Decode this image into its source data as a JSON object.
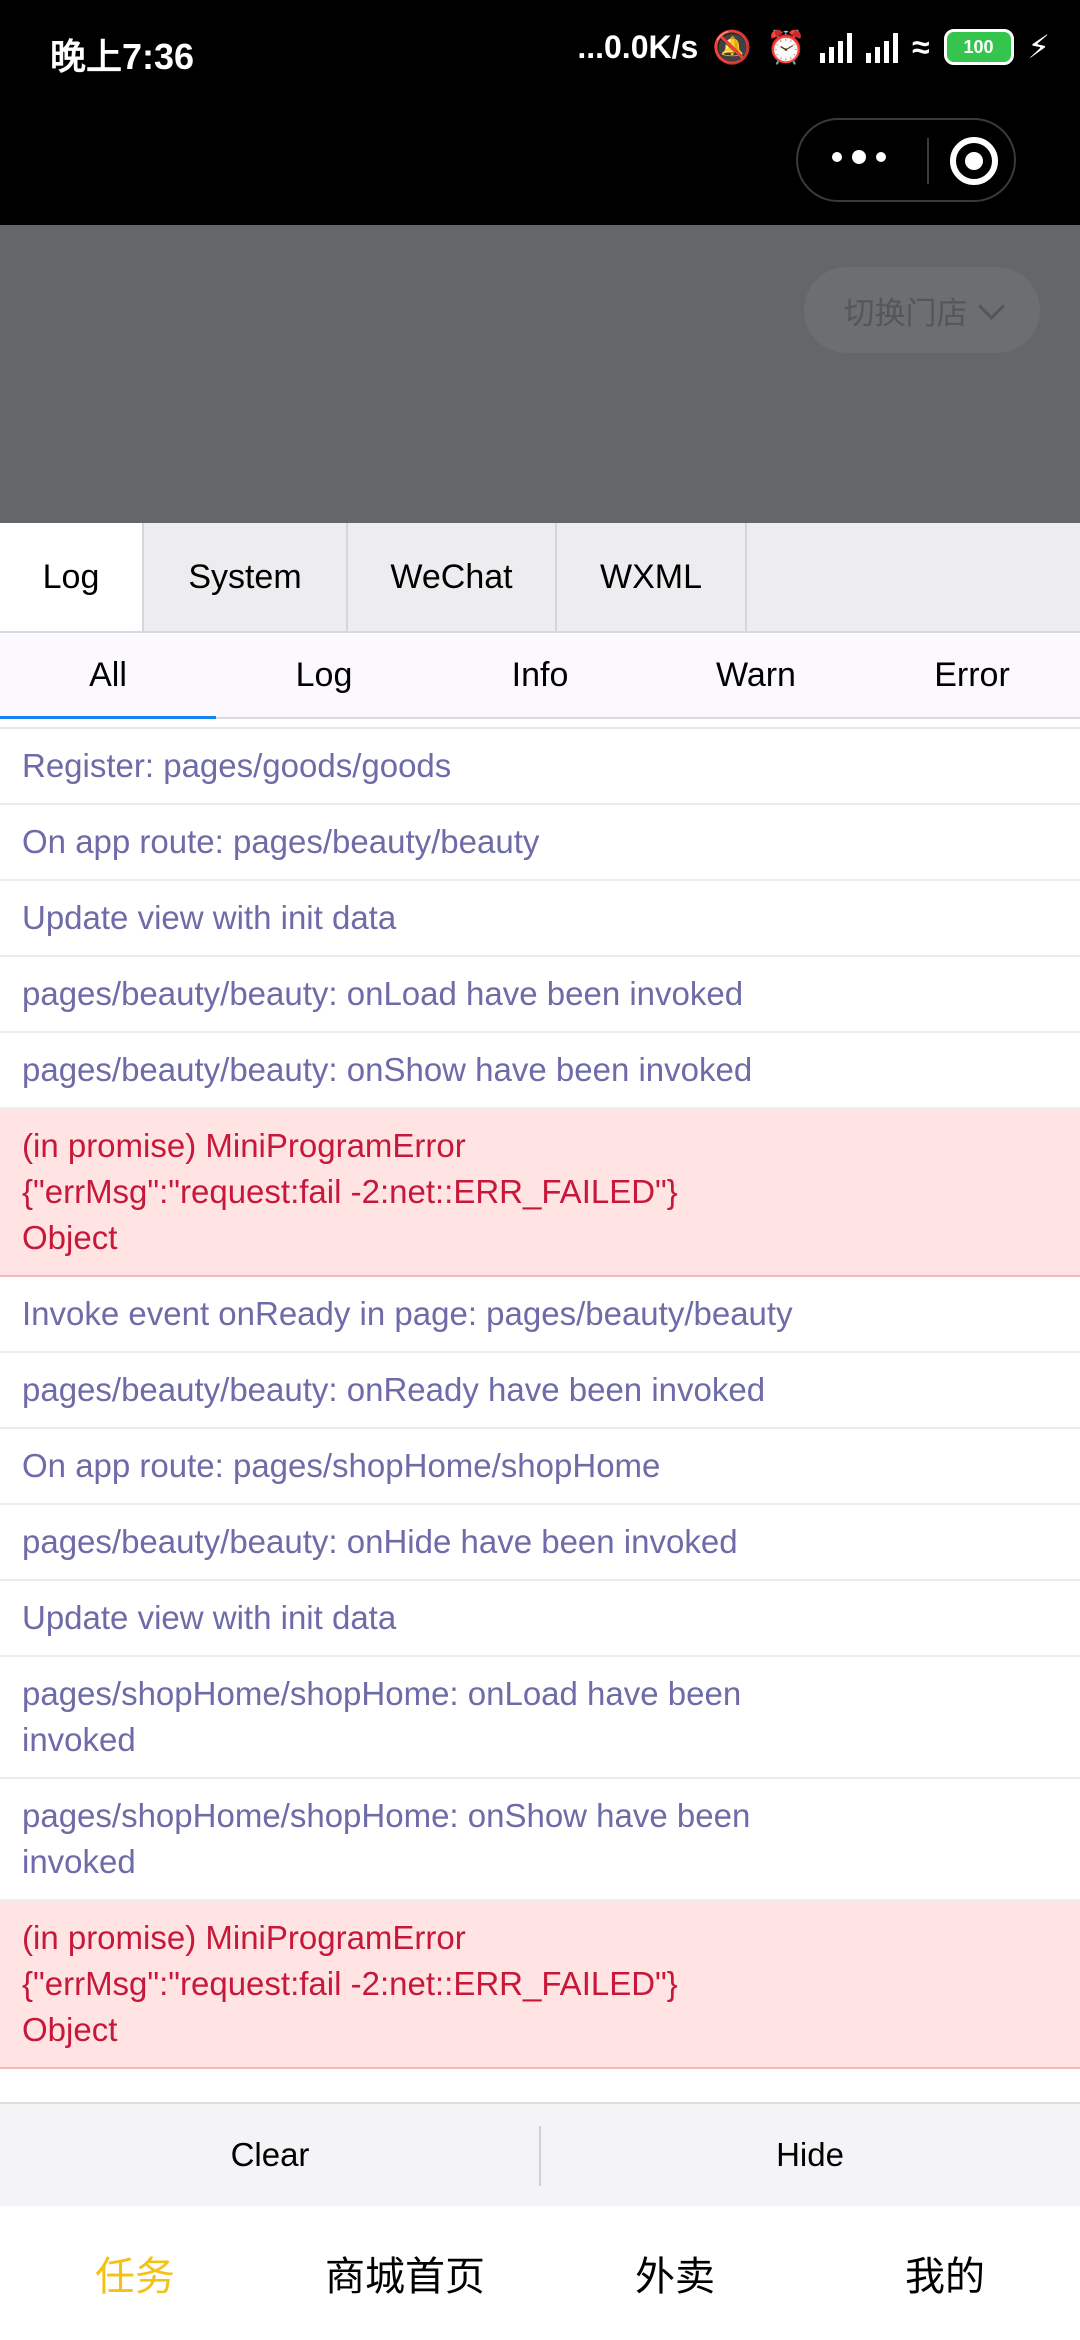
{
  "status_bar": {
    "time": "晚上7:36",
    "net_speed": "...0.0K/s",
    "battery": "100"
  },
  "capsule": {
    "more_icon": "more-dots-icon",
    "close_icon": "close-circle-icon"
  },
  "page": {
    "switch_store_label": "切换门店"
  },
  "console": {
    "main_tabs": [
      "Log",
      "System",
      "WeChat",
      "WXML"
    ],
    "sub_tabs": [
      "All",
      "Log",
      "Info",
      "Warn",
      "Error"
    ],
    "logs": [
      {
        "text": "Register: pages/goods/goods",
        "level": "log"
      },
      {
        "text": "On app route: pages/beauty/beauty",
        "level": "log"
      },
      {
        "text": "Update view with init data",
        "level": "log"
      },
      {
        "text": "pages/beauty/beauty: onLoad have been invoked",
        "level": "log"
      },
      {
        "text": "pages/beauty/beauty: onShow have been invoked",
        "level": "log"
      },
      {
        "text": "(in promise) MiniProgramError\n{\"errMsg\":\"request:fail -2:net::ERR_FAILED\"}\nObject",
        "level": "error"
      },
      {
        "text": "Invoke event onReady in page: pages/beauty/beauty",
        "level": "log"
      },
      {
        "text": "pages/beauty/beauty: onReady have been invoked",
        "level": "log"
      },
      {
        "text": "On app route: pages/shopHome/shopHome",
        "level": "log"
      },
      {
        "text": "pages/beauty/beauty: onHide have been invoked",
        "level": "log"
      },
      {
        "text": "Update view with init data",
        "level": "log"
      },
      {
        "text": "pages/shopHome/shopHome: onLoad have been\ninvoked",
        "level": "log"
      },
      {
        "text": "pages/shopHome/shopHome: onShow have been\ninvoked",
        "level": "log"
      },
      {
        "text": "(in promise) MiniProgramError\n{\"errMsg\":\"request:fail -2:net::ERR_FAILED\"}\nObject",
        "level": "error"
      }
    ],
    "toolbar": {
      "clear_label": "Clear",
      "hide_label": "Hide"
    }
  },
  "tabbar": {
    "items": [
      "任务",
      "商城首页",
      "外卖",
      "我的"
    ],
    "active_color": "#f3c214"
  }
}
